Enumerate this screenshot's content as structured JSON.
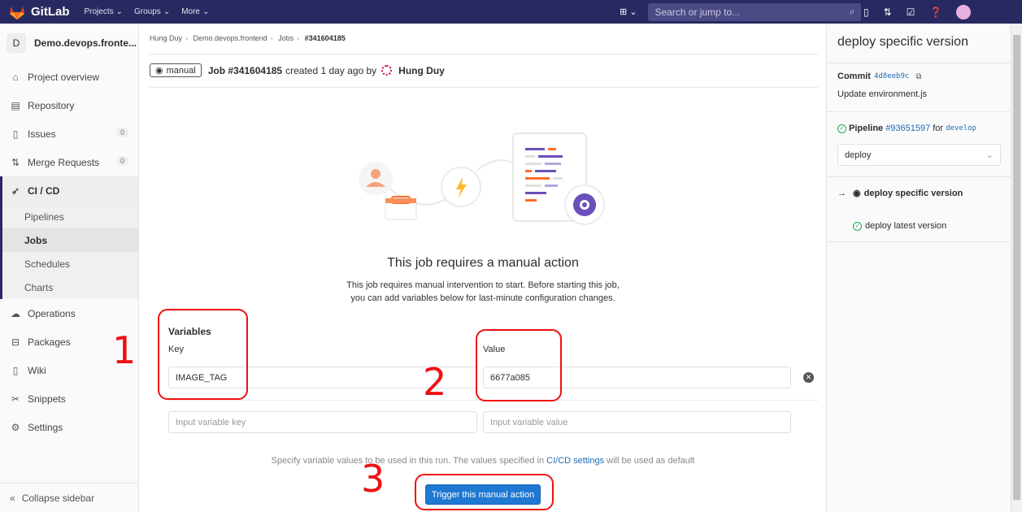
{
  "navbar": {
    "brand": "GitLab",
    "menus": [
      "Projects",
      "Groups",
      "More"
    ],
    "search_placeholder": "Search or jump to..."
  },
  "sidebar": {
    "project_initial": "D",
    "project_name": "Demo.devops.fronte...",
    "items": [
      {
        "label": "Project overview"
      },
      {
        "label": "Repository"
      },
      {
        "label": "Issues",
        "count": "0"
      },
      {
        "label": "Merge Requests",
        "count": "0"
      },
      {
        "label": "CI / CD"
      }
    ],
    "sub_items": [
      "Pipelines",
      "Jobs",
      "Schedules",
      "Charts"
    ],
    "items_after": [
      {
        "label": "Operations"
      },
      {
        "label": "Packages"
      },
      {
        "label": "Wiki"
      },
      {
        "label": "Snippets"
      },
      {
        "label": "Settings"
      }
    ],
    "collapse_label": "Collapse sidebar"
  },
  "breadcrumb": [
    "Hung Duy",
    "Demo.devops.frontend",
    "Jobs",
    "#341604185"
  ],
  "job": {
    "status": "manual",
    "title": "Job #341604185",
    "created_text": "created 1 day ago by",
    "user": "Hung Duy"
  },
  "manual": {
    "title": "This job requires a manual action",
    "desc_line1": "This job requires manual intervention to start. Before starting this job,",
    "desc_line2": "you can add variables below for last-minute configuration changes."
  },
  "variables": {
    "heading": "Variables",
    "key_label": "Key",
    "value_label": "Value",
    "rows": [
      {
        "key": "IMAGE_TAG",
        "value": "6677a085"
      }
    ],
    "key_placeholder": "Input variable key",
    "value_placeholder": "Input variable value"
  },
  "hint": {
    "before": "Specify variable values to be used in this run. The values specified in ",
    "link": "CI/CD settings",
    "after": " will be used as default"
  },
  "trigger_label": "Trigger this manual action",
  "annotations": [
    "1",
    "2",
    "3"
  ],
  "right_sidebar": {
    "title": "deploy specific version",
    "commit_label": "Commit",
    "commit_sha": "4d8eeb9c",
    "commit_message": "Update environment.js",
    "pipeline_label": "Pipeline",
    "pipeline_id": "#93651597",
    "pipeline_for": "for",
    "pipeline_ref": "develop",
    "stage": "deploy",
    "jobs": [
      {
        "label": "deploy specific version",
        "active": true
      },
      {
        "label": "deploy latest version",
        "active": false
      }
    ]
  },
  "colors": {
    "navbar": "#292961",
    "primary_button": "#1f78d1",
    "annotation": "#ee1111",
    "success": "#1aaa55"
  }
}
